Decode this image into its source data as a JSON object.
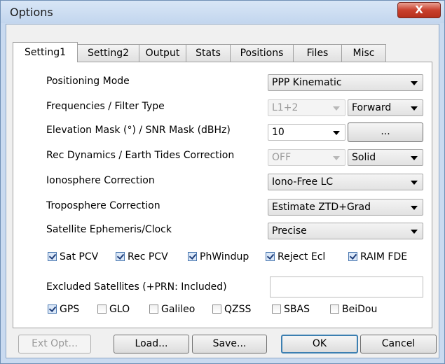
{
  "window": {
    "title": "Options",
    "close_label": "X"
  },
  "tabs": [
    {
      "label": "Setting1",
      "active": true
    },
    {
      "label": "Setting2",
      "active": false
    },
    {
      "label": "Output",
      "active": false
    },
    {
      "label": "Stats",
      "active": false
    },
    {
      "label": "Positions",
      "active": false
    },
    {
      "label": "Files",
      "active": false
    },
    {
      "label": "Misc",
      "active": false
    }
  ],
  "settings": {
    "positioning_mode": {
      "label": "Positioning Mode",
      "value": "PPP Kinematic"
    },
    "frequencies": {
      "label": "Frequencies / Filter Type",
      "freq_value": "L1+2",
      "filter_value": "Forward"
    },
    "elevation": {
      "label": "Elevation Mask (°) / SNR Mask (dBHz)",
      "value": "10",
      "snr_button": "..."
    },
    "rec_dynamics": {
      "label": "Rec Dynamics / Earth Tides Correction",
      "dyn_value": "OFF",
      "tide_value": "Solid"
    },
    "ionosphere": {
      "label": "Ionosphere Correction",
      "value": "Iono-Free LC"
    },
    "troposphere": {
      "label": "Troposphere Correction",
      "value": "Estimate ZTD+Grad"
    },
    "ephemeris": {
      "label": "Satellite Ephemeris/Clock",
      "value": "Precise"
    }
  },
  "options_checks": [
    {
      "label": "Sat PCV",
      "checked": true
    },
    {
      "label": "Rec PCV",
      "checked": true
    },
    {
      "label": "PhWindup",
      "checked": true
    },
    {
      "label": "Reject Ecl",
      "checked": true
    },
    {
      "label": "RAIM FDE",
      "checked": true
    }
  ],
  "excluded": {
    "label": "Excluded Satellites (+PRN: Included)",
    "value": ""
  },
  "constellations": [
    {
      "label": "GPS",
      "checked": true
    },
    {
      "label": "GLO",
      "checked": false
    },
    {
      "label": "Galileo",
      "checked": false
    },
    {
      "label": "QZSS",
      "checked": false
    },
    {
      "label": "SBAS",
      "checked": false
    },
    {
      "label": "BeiDou",
      "checked": false
    }
  ],
  "buttons": {
    "ext_opt": "Ext Opt...",
    "load": "Load...",
    "save": "Save...",
    "ok": "OK",
    "cancel": "Cancel"
  }
}
